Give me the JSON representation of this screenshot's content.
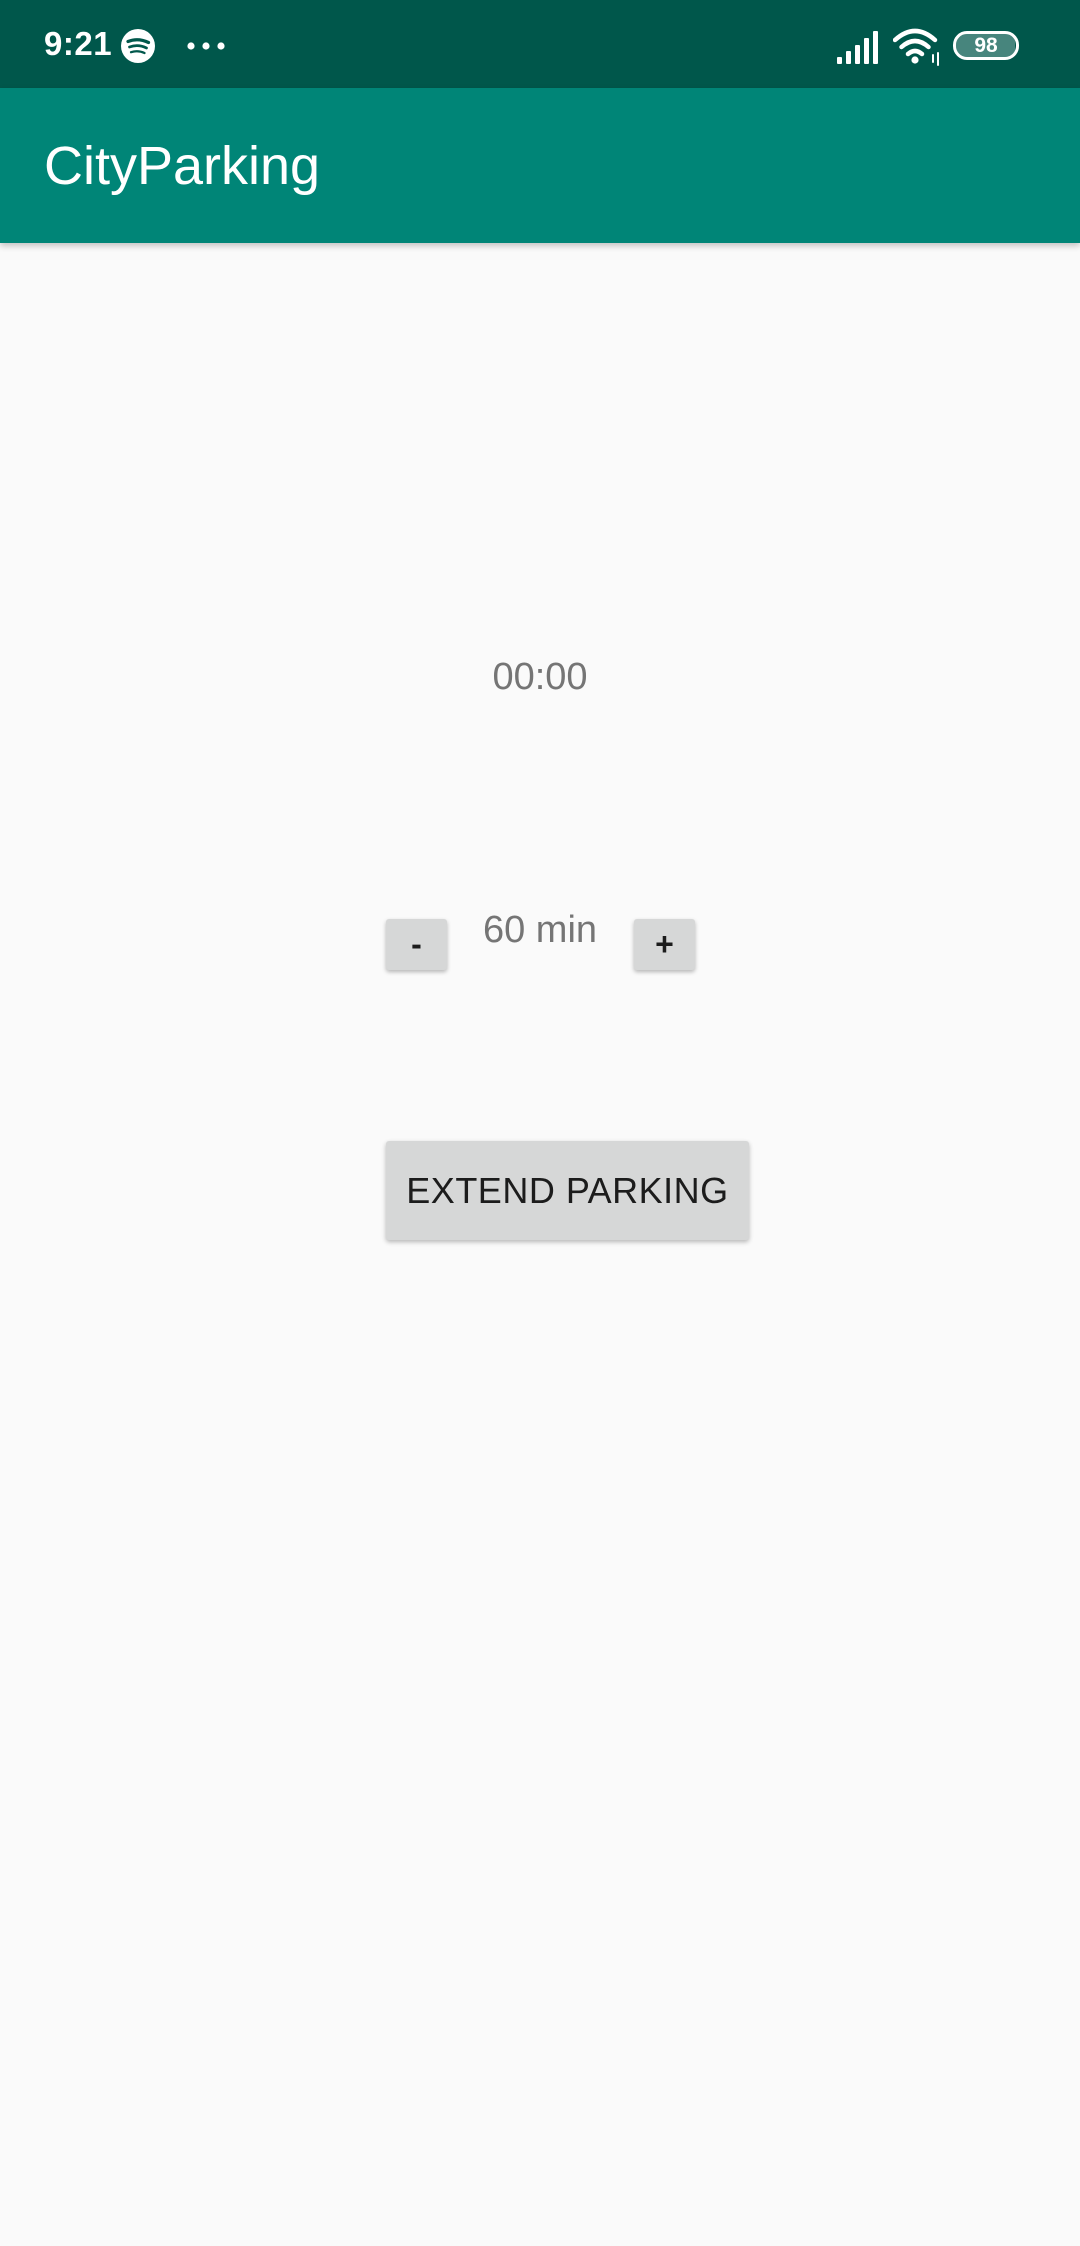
{
  "status_bar": {
    "time": "9:21",
    "battery_level": "98",
    "battery_fraction": 0.98,
    "icons": [
      "spotify-icon",
      "more-dots-icon",
      "signal-icon",
      "wifi-icon",
      "battery-icon"
    ]
  },
  "app_bar": {
    "title": "CityParking"
  },
  "main": {
    "timer": "00:00",
    "decrement_label": "-",
    "duration": "60 min",
    "increment_label": "+",
    "extend_label": "EXTEND PARKING"
  },
  "colors": {
    "status_bar": "#00574b",
    "app_bar": "#008577",
    "background": "#fafafa",
    "button": "#d6d7d7",
    "secondary_text": "#757575"
  }
}
